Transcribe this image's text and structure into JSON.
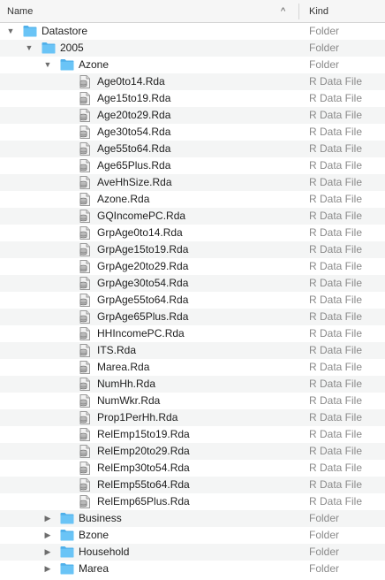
{
  "header": {
    "name_label": "Name",
    "sort_indicator": "^",
    "kind_label": "Kind"
  },
  "icons": {
    "folder": "folder-icon",
    "file": "r-data-file-icon",
    "expanded": "disclosure-expanded-icon",
    "collapsed": "disclosure-collapsed-icon"
  },
  "colors": {
    "folder_fill": "#6ac4f6",
    "folder_tab": "#4fb0ea",
    "alt_row": "#f4f5f5"
  },
  "rows": [
    {
      "name": "Datastore",
      "kind": "Folder",
      "type": "folder",
      "depth": 0,
      "expanded": true
    },
    {
      "name": "2005",
      "kind": "Folder",
      "type": "folder",
      "depth": 1,
      "expanded": true
    },
    {
      "name": "Azone",
      "kind": "Folder",
      "type": "folder",
      "depth": 2,
      "expanded": true
    },
    {
      "name": "Age0to14.Rda",
      "kind": "R Data File",
      "type": "file",
      "depth": 3
    },
    {
      "name": "Age15to19.Rda",
      "kind": "R Data File",
      "type": "file",
      "depth": 3
    },
    {
      "name": "Age20to29.Rda",
      "kind": "R Data File",
      "type": "file",
      "depth": 3
    },
    {
      "name": "Age30to54.Rda",
      "kind": "R Data File",
      "type": "file",
      "depth": 3
    },
    {
      "name": "Age55to64.Rda",
      "kind": "R Data File",
      "type": "file",
      "depth": 3
    },
    {
      "name": "Age65Plus.Rda",
      "kind": "R Data File",
      "type": "file",
      "depth": 3
    },
    {
      "name": "AveHhSize.Rda",
      "kind": "R Data File",
      "type": "file",
      "depth": 3
    },
    {
      "name": "Azone.Rda",
      "kind": "R Data File",
      "type": "file",
      "depth": 3
    },
    {
      "name": "GQIncomePC.Rda",
      "kind": "R Data File",
      "type": "file",
      "depth": 3
    },
    {
      "name": "GrpAge0to14.Rda",
      "kind": "R Data File",
      "type": "file",
      "depth": 3
    },
    {
      "name": "GrpAge15to19.Rda",
      "kind": "R Data File",
      "type": "file",
      "depth": 3
    },
    {
      "name": "GrpAge20to29.Rda",
      "kind": "R Data File",
      "type": "file",
      "depth": 3
    },
    {
      "name": "GrpAge30to54.Rda",
      "kind": "R Data File",
      "type": "file",
      "depth": 3
    },
    {
      "name": "GrpAge55to64.Rda",
      "kind": "R Data File",
      "type": "file",
      "depth": 3
    },
    {
      "name": "GrpAge65Plus.Rda",
      "kind": "R Data File",
      "type": "file",
      "depth": 3
    },
    {
      "name": "HHIncomePC.Rda",
      "kind": "R Data File",
      "type": "file",
      "depth": 3
    },
    {
      "name": "ITS.Rda",
      "kind": "R Data File",
      "type": "file",
      "depth": 3
    },
    {
      "name": "Marea.Rda",
      "kind": "R Data File",
      "type": "file",
      "depth": 3
    },
    {
      "name": "NumHh.Rda",
      "kind": "R Data File",
      "type": "file",
      "depth": 3
    },
    {
      "name": "NumWkr.Rda",
      "kind": "R Data File",
      "type": "file",
      "depth": 3
    },
    {
      "name": "Prop1PerHh.Rda",
      "kind": "R Data File",
      "type": "file",
      "depth": 3
    },
    {
      "name": "RelEmp15to19.Rda",
      "kind": "R Data File",
      "type": "file",
      "depth": 3
    },
    {
      "name": "RelEmp20to29.Rda",
      "kind": "R Data File",
      "type": "file",
      "depth": 3
    },
    {
      "name": "RelEmp30to54.Rda",
      "kind": "R Data File",
      "type": "file",
      "depth": 3
    },
    {
      "name": "RelEmp55to64.Rda",
      "kind": "R Data File",
      "type": "file",
      "depth": 3
    },
    {
      "name": "RelEmp65Plus.Rda",
      "kind": "R Data File",
      "type": "file",
      "depth": 3
    },
    {
      "name": "Business",
      "kind": "Folder",
      "type": "folder",
      "depth": 2,
      "expanded": false
    },
    {
      "name": "Bzone",
      "kind": "Folder",
      "type": "folder",
      "depth": 2,
      "expanded": false
    },
    {
      "name": "Household",
      "kind": "Folder",
      "type": "folder",
      "depth": 2,
      "expanded": false
    },
    {
      "name": "Marea",
      "kind": "Folder",
      "type": "folder",
      "depth": 2,
      "expanded": false
    }
  ]
}
